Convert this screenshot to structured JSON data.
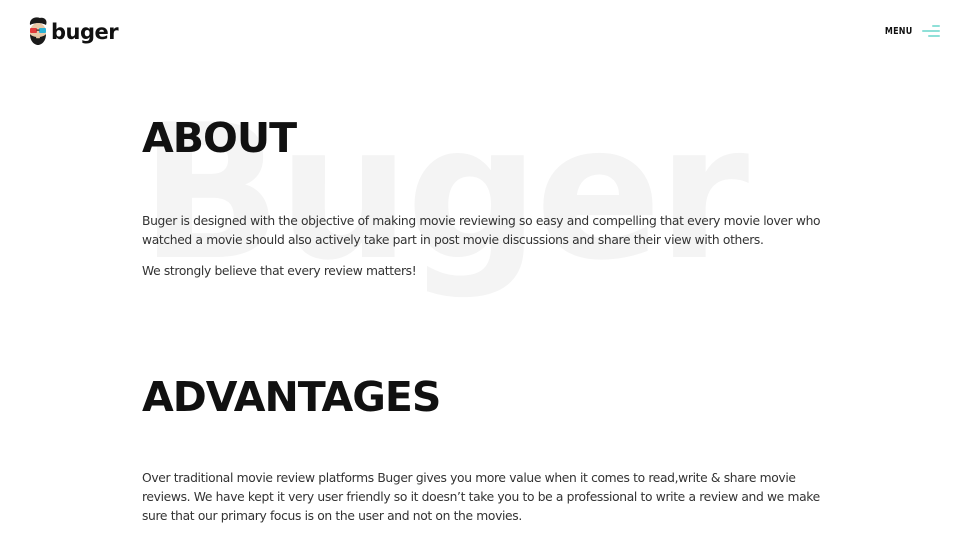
{
  "header": {
    "logo_text": "buger",
    "logo_icon": "hipster-face-3d-glasses-icon",
    "menu_label": "MENU",
    "menu_icon": "hamburger-menu-icon",
    "menu_icon_color": "#8fe0d8"
  },
  "watermark": {
    "text": "Buger",
    "color": "#f4f4f4"
  },
  "about": {
    "title": "ABOUT",
    "paragraphs": [
      "Buger is designed with the objective of making movie reviewing so easy and compelling that every movie lover who watched a movie should also actively take part in post movie discussions and share their view with others.",
      "We strongly believe that every review matters!"
    ]
  },
  "advantages": {
    "title": "ADVANTAGES",
    "paragraphs": [
      "Over traditional movie review platforms Buger gives you more value when it comes to read,write & share movie reviews. We have kept it very user friendly so it doesn’t take you to be a professional to write a review and we make sure that our primary focus is on the user and not on the movies."
    ]
  }
}
